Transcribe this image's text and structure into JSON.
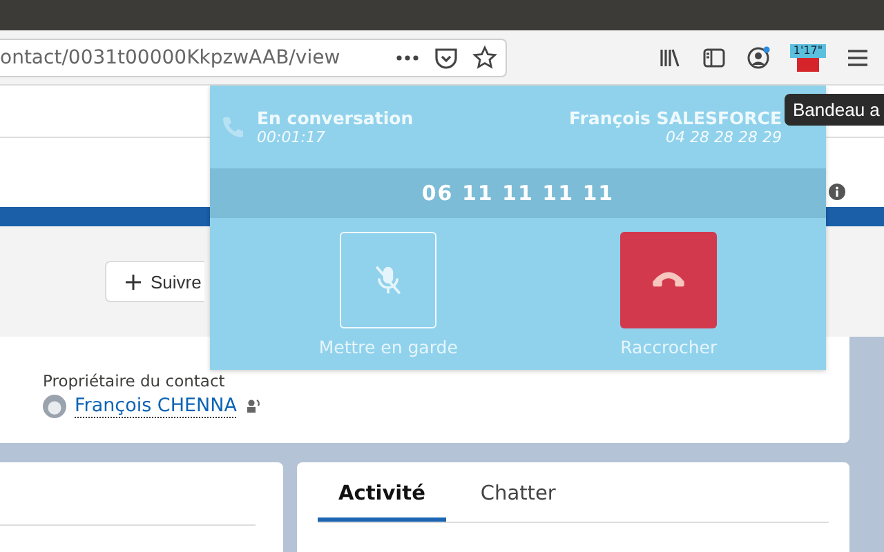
{
  "browser": {
    "url": "ontact/0031t00000KkpzwAAB/view",
    "badge": "1'17\"",
    "tooltip": "Bandeau a"
  },
  "page": {
    "follow_button": "Suivre",
    "owner_label": "Propriétaire du contact",
    "owner_name": "François CHENNA",
    "tabs": [
      {
        "label": "Activité",
        "selected": true
      },
      {
        "label": "Chatter",
        "selected": false
      }
    ]
  },
  "call_panel": {
    "status": "En conversation",
    "duration": "00:01:17",
    "contact_name": "François SALESFORCE",
    "contact_number": "04 28 28 28 29",
    "dialed_number": "06 11 11 11 11",
    "actions": [
      {
        "kind": "hold",
        "label": "Mettre en garde"
      },
      {
        "kind": "hangup",
        "label": "Raccrocher"
      }
    ]
  }
}
